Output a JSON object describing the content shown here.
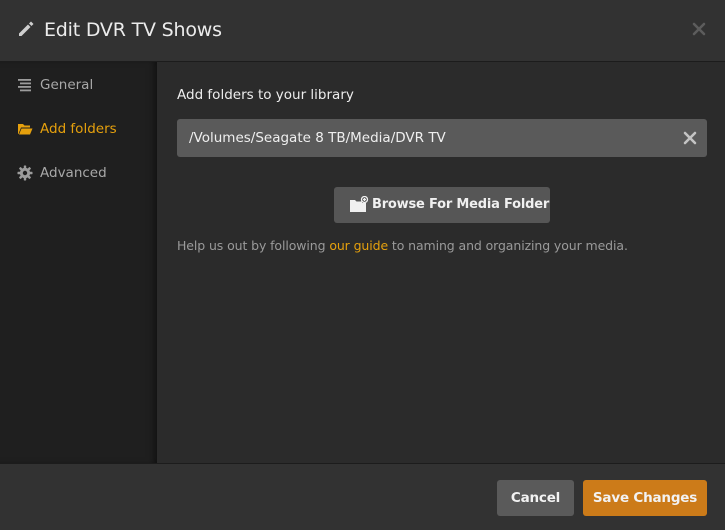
{
  "dialog": {
    "title": "Edit DVR TV Shows",
    "icon": "pencil-icon",
    "close_icon": "close-icon"
  },
  "sidebar": {
    "items": [
      {
        "label": "General",
        "icon": "list-icon",
        "active": false
      },
      {
        "label": "Add folders",
        "icon": "folder-open-icon",
        "active": true
      },
      {
        "label": "Advanced",
        "icon": "gear-icon",
        "active": false
      }
    ]
  },
  "main": {
    "section_label": "Add folders to your library",
    "folder_path": "/Volumes/Seagate 8 TB/Media/DVR TV",
    "browse_button": {
      "label": "Browse For Media Folder",
      "icon": "add-folder-icon"
    },
    "help": {
      "prefix": "Help us out by following ",
      "link": "our guide",
      "suffix": " to naming and organizing your media."
    }
  },
  "footer": {
    "cancel_label": "Cancel",
    "save_label": "Save Changes"
  },
  "colors": {
    "accent": "#e5a00d",
    "save_button": "#cc7b19"
  }
}
